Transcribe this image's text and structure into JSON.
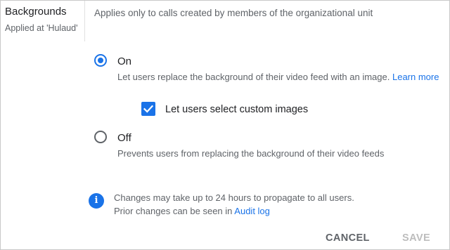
{
  "setting": {
    "title": "Backgrounds",
    "applied_at": "Applied at 'Hulaud'",
    "description": "Applies only to calls created by members of the organizational unit"
  },
  "options": {
    "on": {
      "label": "On",
      "selected": true,
      "description": "Let users replace the background of their video feed with an image.",
      "learn_more": "Learn more"
    },
    "custom_images": {
      "label": "Let users select custom images",
      "checked": true
    },
    "off": {
      "label": "Off",
      "selected": false,
      "description": "Prevents users from replacing the background of their video feeds"
    }
  },
  "info": {
    "icon": "info-icon",
    "line1": "Changes may take up to 24 hours to propagate to all users.",
    "line2_prefix": "Prior changes can be seen in",
    "audit_link": "Audit log"
  },
  "buttons": {
    "cancel": "CANCEL",
    "save": "SAVE"
  },
  "colors": {
    "accent": "#1a73e8",
    "disabled": "#bdbdbd"
  }
}
